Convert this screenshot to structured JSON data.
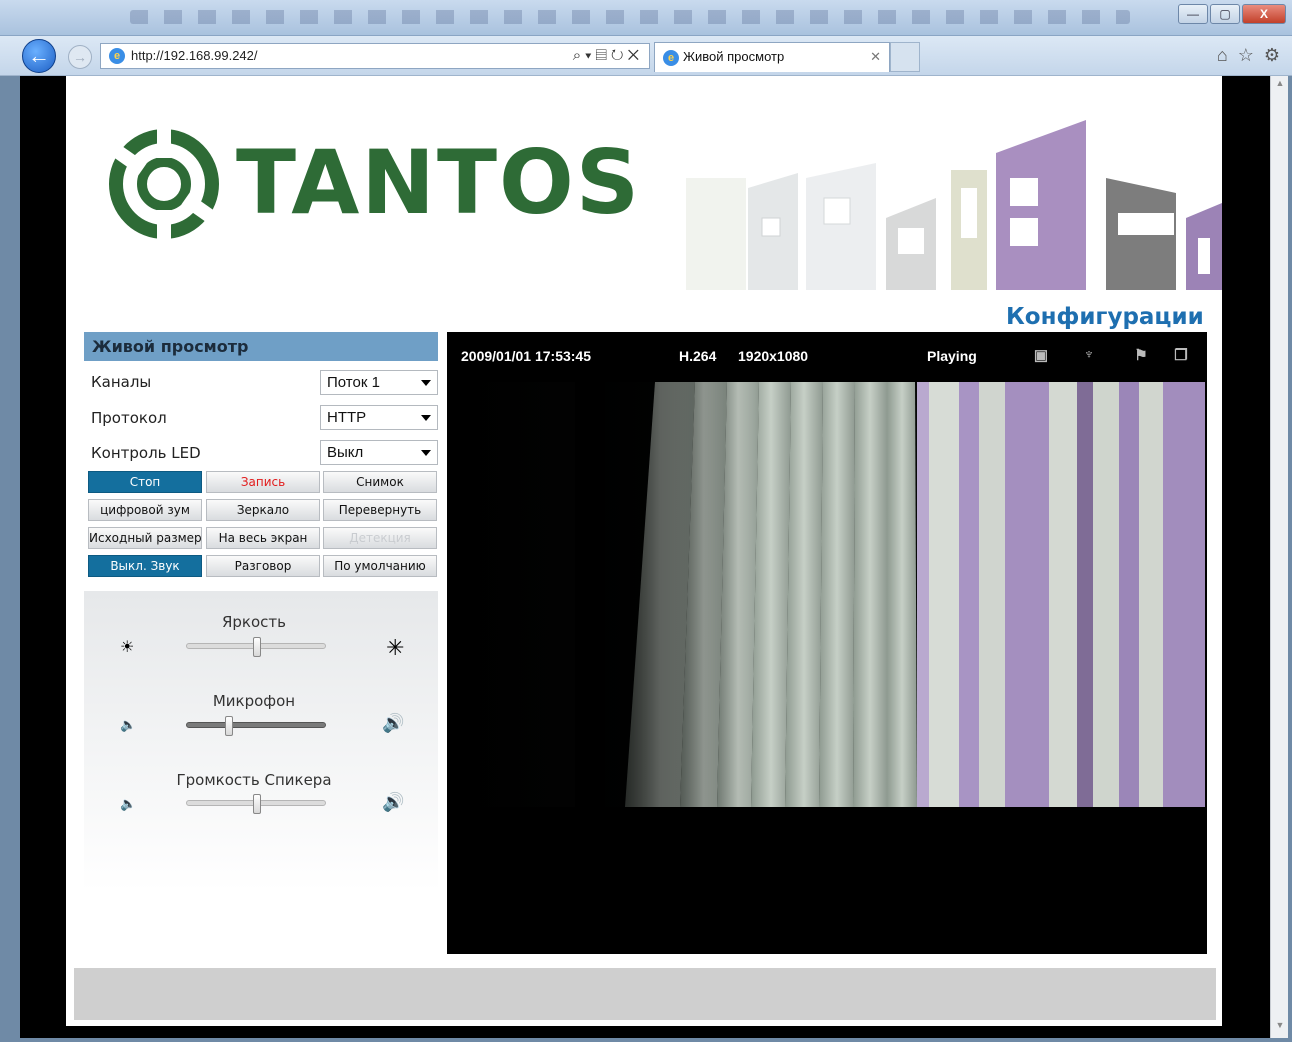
{
  "browser": {
    "url": "http://192.168.99.242/",
    "tab_title": "Живой просмотр",
    "window_buttons": {
      "minimize": "—",
      "maximize": "▢",
      "close": "X"
    }
  },
  "header": {
    "brand": "TANTOS",
    "config_link": "Конфигурации"
  },
  "panel": {
    "title": "Живой просмотр",
    "rows": [
      {
        "label": "Каналы",
        "value": "Поток 1"
      },
      {
        "label": "Протокол",
        "value": "HTTP"
      },
      {
        "label": "Контроль LED",
        "value": "Выкл"
      }
    ],
    "buttons": [
      {
        "label": "Стоп",
        "state": "active"
      },
      {
        "label": "Запись",
        "state": "rec"
      },
      {
        "label": "Снимок",
        "state": "normal"
      },
      {
        "label": "цифровой зум",
        "state": "normal"
      },
      {
        "label": "Зеркало",
        "state": "normal"
      },
      {
        "label": "Перевернуть",
        "state": "normal"
      },
      {
        "label": "Исходный размер",
        "state": "normal"
      },
      {
        "label": "На весь экран",
        "state": "normal"
      },
      {
        "label": "Детекция",
        "state": "disabled"
      },
      {
        "label": "Выкл. Звук",
        "state": "active"
      },
      {
        "label": "Разговор",
        "state": "normal"
      },
      {
        "label": "По умолчанию",
        "state": "normal"
      }
    ],
    "sliders": [
      {
        "label": "Яркость",
        "level": 0.5,
        "fill": "light",
        "icon_low": "☀",
        "icon_high": "✳"
      },
      {
        "label": "Микрофон",
        "level": 0.3,
        "fill": "dark",
        "icon_low": "🔈",
        "icon_high": "🔊"
      },
      {
        "label": "Громкость Спикера",
        "level": 0.5,
        "fill": "light",
        "icon_low": "🔈",
        "icon_high": "🔊"
      }
    ]
  },
  "video": {
    "datetime": "2009/01/01  17:53:45",
    "codec": "H.264",
    "resolution": "1920x1080",
    "status": "Playing",
    "icons": [
      "camera-icon",
      "microphone-icon",
      "flag-icon",
      "window-icon"
    ]
  },
  "colors": {
    "brand_green": "#2e6b36",
    "panel_header": "#6f9fc6",
    "active_button": "#146f9e",
    "config_link": "#1e6fb0"
  }
}
